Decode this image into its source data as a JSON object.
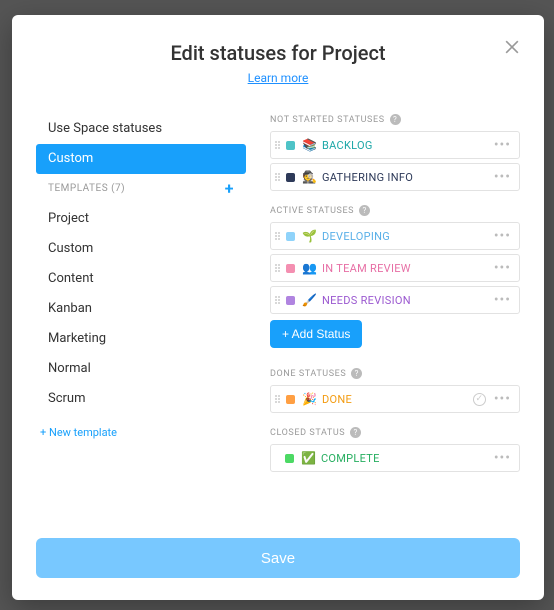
{
  "header": {
    "title": "Edit statuses for Project",
    "learn_more": "Learn more"
  },
  "sidebar": {
    "use_space": "Use Space statuses",
    "custom": "Custom",
    "templates_label": "TEMPLATES (7)",
    "templates": [
      "Project",
      "Custom",
      "Content",
      "Kanban",
      "Marketing",
      "Normal",
      "Scrum"
    ],
    "new_template": "+ New template"
  },
  "groups": {
    "not_started": {
      "label": "NOT STARTED STATUSES"
    },
    "active": {
      "label": "ACTIVE STATUSES"
    },
    "done": {
      "label": "DONE STATUSES"
    },
    "closed": {
      "label": "CLOSED STATUS"
    }
  },
  "statuses": {
    "not_started": [
      {
        "name": "BACKLOG",
        "emoji": "📚",
        "color": "teal"
      },
      {
        "name": "GATHERING INFO",
        "emoji": "🕵️",
        "color": "navy"
      }
    ],
    "active": [
      {
        "name": "DEVELOPING",
        "emoji": "🌱",
        "color": "sky"
      },
      {
        "name": "IN TEAM REVIEW",
        "emoji": "👥",
        "color": "pink"
      },
      {
        "name": "NEEDS REVISION",
        "emoji": "🖌️",
        "color": "purple"
      }
    ],
    "done": [
      {
        "name": "DONE",
        "emoji": "🎉",
        "color": "orange"
      }
    ],
    "closed": {
      "name": "COMPLETE",
      "emoji": "✅",
      "color": "green"
    }
  },
  "buttons": {
    "add_status": "+ Add Status",
    "save": "Save"
  }
}
